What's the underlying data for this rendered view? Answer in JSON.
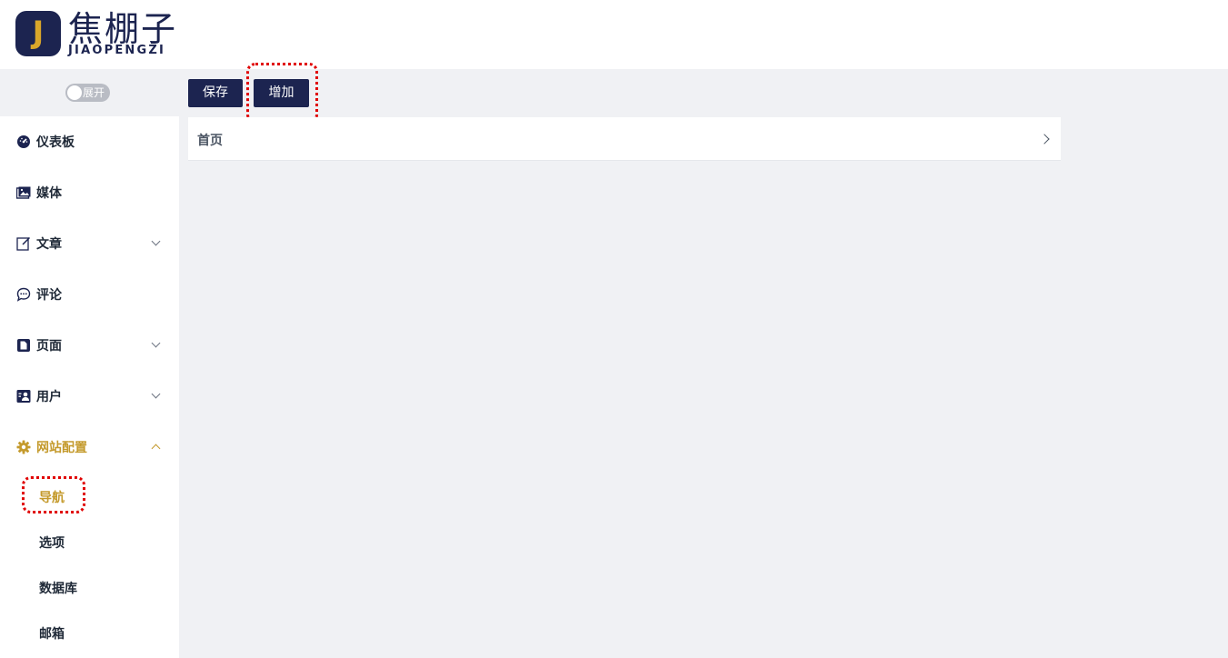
{
  "brand": {
    "logo_letter": "J",
    "name_cn": "焦棚子",
    "name_en": "JIAOPENGZI",
    "accent_color": "#1c2450",
    "highlight_color": "#c49a2c"
  },
  "sidebar": {
    "toggle_label": "展开",
    "items": [
      {
        "label": "仪表板",
        "icon": "dashboard-icon"
      },
      {
        "label": "媒体",
        "icon": "media-icon"
      },
      {
        "label": "文章",
        "icon": "edit-icon",
        "expandable": true
      },
      {
        "label": "评论",
        "icon": "comment-icon"
      },
      {
        "label": "页面",
        "icon": "page-icon",
        "expandable": true
      },
      {
        "label": "用户",
        "icon": "user-icon",
        "expandable": true
      },
      {
        "label": "网站配置",
        "icon": "gear-icon",
        "expandable": true,
        "expanded": true
      }
    ],
    "sub_items": [
      {
        "label": "导航",
        "active": true
      },
      {
        "label": "选项"
      },
      {
        "label": "数据库"
      },
      {
        "label": "邮箱"
      }
    ]
  },
  "toolbar": {
    "save_label": "保存",
    "add_label": "增加"
  },
  "nav_list": {
    "items": [
      {
        "label": "首页"
      }
    ]
  }
}
